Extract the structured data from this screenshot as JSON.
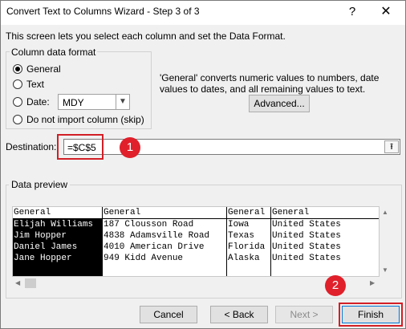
{
  "window": {
    "title": "Convert Text to Columns Wizard - Step 3 of 3",
    "help_label": "?",
    "close_label": "✕"
  },
  "intro_text": "This screen lets you select each column and set the Data Format.",
  "column_format": {
    "title": "Column data format",
    "options": [
      "General",
      "Text",
      "Date:",
      "Do not import column (skip)"
    ],
    "selected": "General",
    "date_format": "MDY"
  },
  "description": "'General' converts numeric values to numbers, date values to dates, and all remaining values to text.",
  "advanced_label": "Advanced...",
  "destination": {
    "label": "Destination:",
    "value": "=$C$5",
    "collapse_label": "⭱"
  },
  "badges": [
    "1",
    "2"
  ],
  "preview": {
    "title": "Data preview",
    "columns": [
      {
        "header": "General",
        "cells": [
          "Elijah Williams",
          "Jim Hopper",
          "Daniel James",
          "Jane Hopper"
        ]
      },
      {
        "header": "General",
        "cells": [
          "187 Clousson Road",
          " 4838 Adamsville Road",
          "4010 American Drive",
          "949 Kidd Avenue"
        ]
      },
      {
        "header": "General",
        "cells": [
          "Iowa",
          "Texas",
          "Florida",
          "Alaska"
        ]
      },
      {
        "header": "General",
        "cells": [
          "United States",
          " United States",
          "United States",
          "United States"
        ]
      }
    ]
  },
  "buttons": {
    "cancel": "Cancel",
    "back": "< Back",
    "next": "Next >",
    "finish": "Finish"
  },
  "colors": {
    "highlight": "#d21f26",
    "badge": "#e0202a"
  }
}
